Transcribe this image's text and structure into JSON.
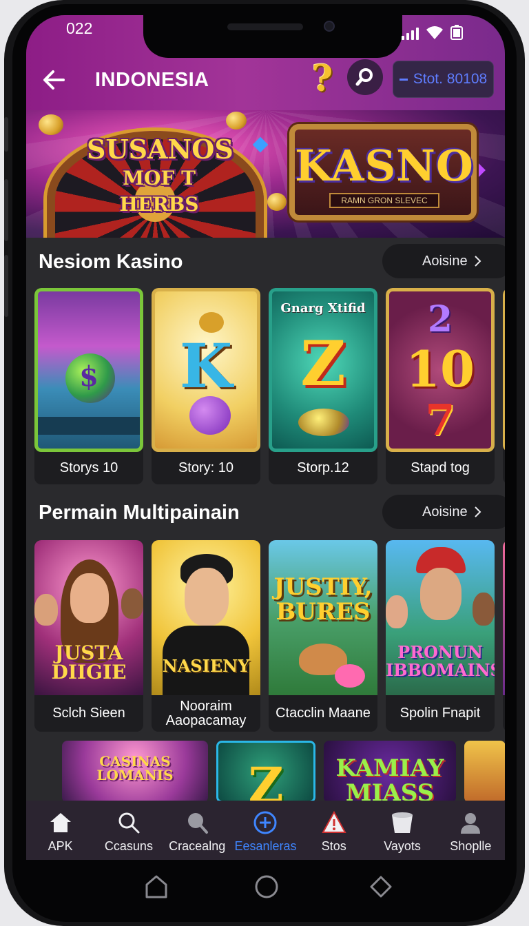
{
  "status_bar": {
    "time": "022"
  },
  "app_bar": {
    "title": "INDONESIA",
    "help_symbol": "?",
    "stat_button_label": "Stot. 80108"
  },
  "banner": {
    "left_title_line1": "SUSANOS",
    "left_title_line2": "MOF T HERBS",
    "right_title": "KASNO",
    "right_subtitle": "RAMN GRON SLEVEC"
  },
  "section1": {
    "title": "Nesiom Kasino",
    "more_label": "Aoisine",
    "cards": [
      {
        "label": "Storys 10",
        "art_text": "$"
      },
      {
        "label": "Story: 10",
        "art_text": "K"
      },
      {
        "label": "Storp.12",
        "art_text": "Z",
        "art_caption": "Gnarg Xtifid"
      },
      {
        "label": "Stapd tog",
        "art_text": "10",
        "art_top": "2",
        "art_bottom": "7"
      }
    ]
  },
  "section2": {
    "title": "Permain Multipainain",
    "more_label": "Aoisine",
    "cards": [
      {
        "label": "Sclch Sieen",
        "art_text": "JUSTA DIIGIE"
      },
      {
        "label": "Nooraim Aaopacamay",
        "art_text": "NASIENY"
      },
      {
        "label": "Ctacclin Maane",
        "art_text": "JUSTIY, BURES"
      },
      {
        "label": "Spolin Fnapit",
        "art_text": "PRONUN IBBOMAINS"
      }
    ]
  },
  "row3": {
    "items": [
      {
        "art_text": "CASINAS LOMANIS"
      },
      {
        "art_text": "Z"
      },
      {
        "art_text": "KAMIAY MIASS"
      }
    ]
  },
  "bottom_nav": {
    "items": [
      {
        "label": "APK",
        "icon": "home-icon"
      },
      {
        "label": "Ccasuns",
        "icon": "search-icon"
      },
      {
        "label": "Cracealng",
        "icon": "search-filled-icon"
      },
      {
        "label": "Eesanleras",
        "icon": "plus-circle-icon",
        "active": true
      },
      {
        "label": "Stos",
        "icon": "warning-icon"
      },
      {
        "label": "Vayots",
        "icon": "bucket-icon"
      },
      {
        "label": "Shoplle",
        "icon": "user-icon"
      }
    ]
  },
  "colors": {
    "header_gradient_start": "#8d1d86",
    "header_gradient_end": "#7a2a8c",
    "accent_blue": "#3f86ff",
    "stat_text": "#5f7dff",
    "gold": "#f5c030"
  }
}
